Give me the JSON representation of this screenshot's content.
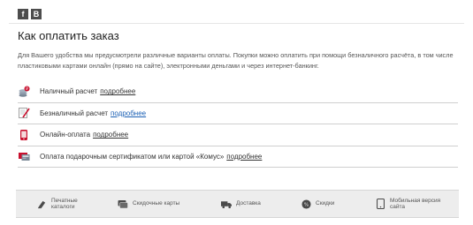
{
  "social": {
    "facebook_glyph": "f",
    "vk_glyph": "В"
  },
  "page": {
    "title": "Как оплатить заказ",
    "intro": "Для Вашего удобства мы предусмотрели различные варианты оплаты. Покупки можно оплатить при помощи безналичного расчёта, в том числе пластиковыми картами онлайн (прямо на сайте), электронными деньгами и через интернет-банкинг."
  },
  "methods": [
    {
      "label": "Наличный расчет",
      "link": "подробнее",
      "icon": "cash-coins-icon"
    },
    {
      "label": "Безналичный расчет",
      "link": "подробнее",
      "icon": "invoice-pen-icon"
    },
    {
      "label": "Онлайн-оплата",
      "link": "подробнее",
      "icon": "mobile-payment-icon"
    },
    {
      "label": "Оплата подарочным сертификатом или картой «Комус»",
      "link": "подробнее",
      "icon": "gift-card-icon"
    }
  ],
  "footer": [
    {
      "line1": "Печатные",
      "line2": "каталоги",
      "icon": "catalog-icon"
    },
    {
      "line1": "Скидочные карты",
      "line2": "",
      "icon": "discount-card-icon"
    },
    {
      "line1": "Доставка",
      "line2": "",
      "icon": "truck-icon"
    },
    {
      "line1": "Скидки",
      "line2": "",
      "icon": "discount-badge-icon"
    },
    {
      "line1": "Мобильная версия",
      "line2": "сайта",
      "icon": "mobile-icon"
    }
  ],
  "colors": {
    "link_active": "#1a5fb4",
    "accent_red": "#c8102e",
    "footer_bg": "#ededed"
  }
}
